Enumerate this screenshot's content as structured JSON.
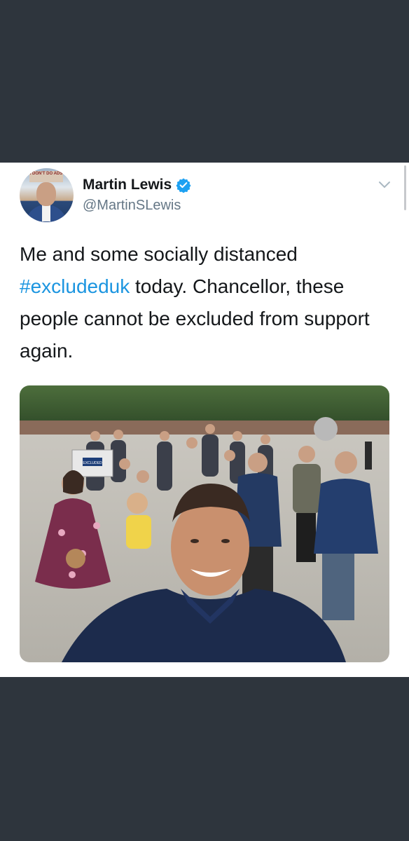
{
  "tweet": {
    "display_name": "Martin Lewis",
    "handle": "@MartinSLewis",
    "verified": true,
    "text_before": "Me and some socially distanced ",
    "hashtag": "#excludeduk",
    "text_after": " today. Chancellor, these people cannot be excluded from support again.",
    "avatar_sign_text": "I DON'T DO ADS",
    "banner_text": "EXCLUDED",
    "icons": [
      "verified-badge-icon",
      "chevron-down-icon"
    ],
    "colors": {
      "background": "#2e353d",
      "card": "#ffffff",
      "text": "#14171a",
      "handle": "#657786",
      "link": "#1b95e0",
      "verified": "#1da1f2"
    }
  }
}
